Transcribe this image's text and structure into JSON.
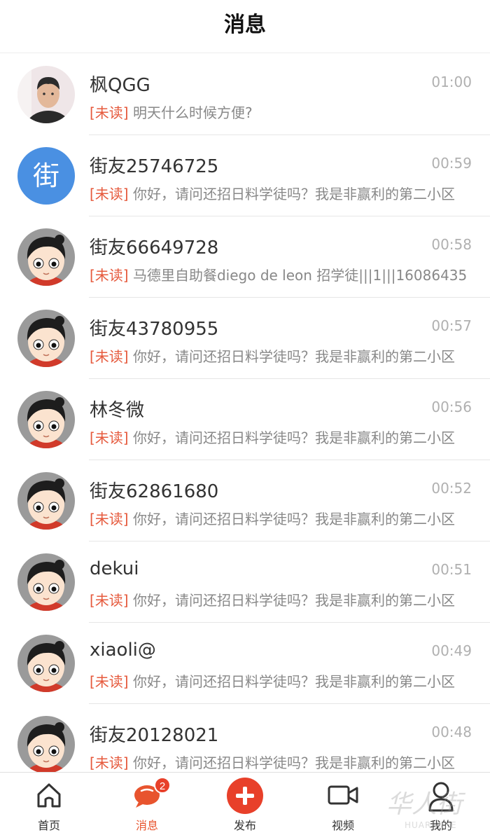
{
  "header": {
    "title": "消息"
  },
  "unread_tag": "[未读]",
  "conversations": [
    {
      "name": "枫QGG",
      "time": "01:00",
      "preview": "明天什么时候方便?",
      "avatar": "photo"
    },
    {
      "name": "街友25746725",
      "time": "00:59",
      "preview": "你好，请问还招日料学徒吗？我是非赢利的第二小区",
      "avatar": "text",
      "avatar_text": "街"
    },
    {
      "name": "街友66649728",
      "time": "00:58",
      "preview": "马德里自助餐diego de leon 招学徒|||1|||16086435",
      "avatar": "cartoon"
    },
    {
      "name": "街友43780955",
      "time": "00:57",
      "preview": "你好，请问还招日料学徒吗？我是非赢利的第二小区",
      "avatar": "cartoon"
    },
    {
      "name": "林冬微",
      "time": "00:56",
      "preview": "你好，请问还招日料学徒吗？我是非赢利的第二小区",
      "avatar": "cartoon"
    },
    {
      "name": "街友62861680",
      "time": "00:52",
      "preview": "你好，请问还招日料学徒吗？我是非赢利的第二小区",
      "avatar": "cartoon"
    },
    {
      "name": "dekui",
      "time": "00:51",
      "preview": "你好，请问还招日料学徒吗？我是非赢利的第二小区",
      "avatar": "cartoon"
    },
    {
      "name": "xiaoli@",
      "time": "00:49",
      "preview": "你好，请问还招日料学徒吗？我是非赢利的第二小区",
      "avatar": "cartoon"
    },
    {
      "name": "街友20128021",
      "time": "00:48",
      "preview": "你好，请问还招日料学徒吗？我是非赢利的第二小区",
      "avatar": "cartoon"
    }
  ],
  "tabbar": {
    "home": {
      "label": "首页",
      "icon": "home-icon"
    },
    "messages": {
      "label": "消息",
      "icon": "chat-bubble-icon",
      "badge": "2"
    },
    "publish": {
      "label": "发布",
      "icon": "plus-circle-icon"
    },
    "video": {
      "label": "视频",
      "icon": "video-camera-icon"
    },
    "mine": {
      "label": "我的",
      "icon": "user-icon"
    }
  },
  "watermark": {
    "text": "华人街",
    "sub": "HUARENJIE"
  },
  "colors": {
    "unread": "#e65a3d",
    "accent": "#e8542e",
    "badge": "#e8402a",
    "avatar_blue": "#4a90e2"
  }
}
